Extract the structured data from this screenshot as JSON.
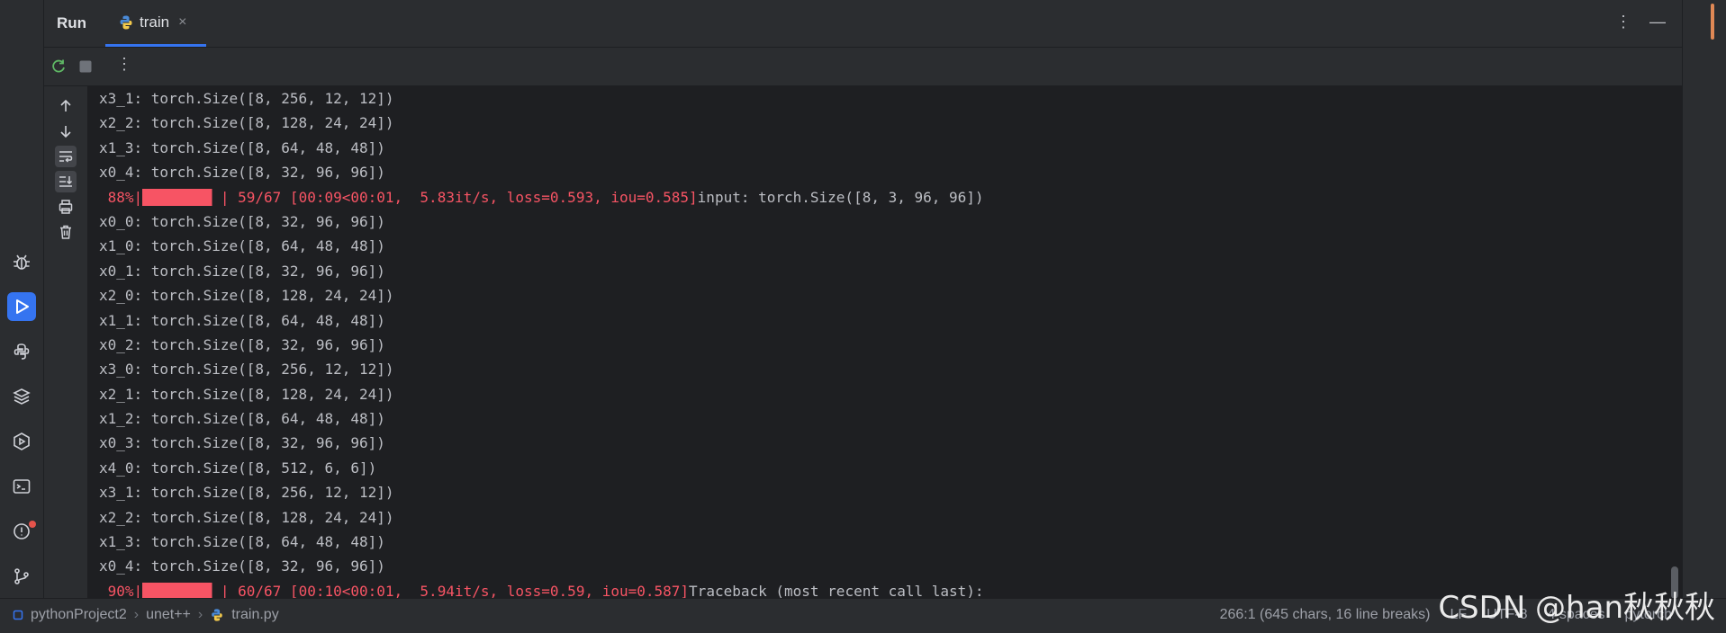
{
  "header": {
    "run_label": "Run",
    "tab_label": "train",
    "tab_close": "×",
    "more_glyph": "⋮",
    "minimize_glyph": "—"
  },
  "toolbar": {
    "more_glyph": "⋮"
  },
  "console": {
    "lines": [
      {
        "text": "x3_1: torch.Size([8, 256, 12, 12])"
      },
      {
        "text": "x2_2: torch.Size([8, 128, 24, 24])"
      },
      {
        "text": "x1_3: torch.Size([8, 64, 48, 48])"
      },
      {
        "text": "x0_4: torch.Size([8, 32, 96, 96])"
      },
      {
        "progress": {
          "pct": " 88%|",
          "bar": "████████",
          "info": " | 59/67 [00:09<00:01,  5.83it/s, loss=0.593, iou=0.585]",
          "tail": "input: torch.Size([8, 3, 96, 96])"
        }
      },
      {
        "text": "x0_0: torch.Size([8, 32, 96, 96])"
      },
      {
        "text": "x1_0: torch.Size([8, 64, 48, 48])"
      },
      {
        "text": "x0_1: torch.Size([8, 32, 96, 96])"
      },
      {
        "text": "x2_0: torch.Size([8, 128, 24, 24])"
      },
      {
        "text": "x1_1: torch.Size([8, 64, 48, 48])"
      },
      {
        "text": "x0_2: torch.Size([8, 32, 96, 96])"
      },
      {
        "text": "x3_0: torch.Size([8, 256, 12, 12])"
      },
      {
        "text": "x2_1: torch.Size([8, 128, 24, 24])"
      },
      {
        "text": "x1_2: torch.Size([8, 64, 48, 48])"
      },
      {
        "text": "x0_3: torch.Size([8, 32, 96, 96])"
      },
      {
        "text": "x4_0: torch.Size([8, 512, 6, 6])"
      },
      {
        "text": "x3_1: torch.Size([8, 256, 12, 12])"
      },
      {
        "text": "x2_2: torch.Size([8, 128, 24, 24])"
      },
      {
        "text": "x1_3: torch.Size([8, 64, 48, 48])"
      },
      {
        "text": "x0_4: torch.Size([8, 32, 96, 96])"
      },
      {
        "progress": {
          "pct": " 90%|",
          "bar": "████████",
          "info": " | 60/67 [00:10<00:01,  5.94it/s, loss=0.59, iou=0.587]",
          "tail": "Traceback (most recent call last):"
        }
      }
    ]
  },
  "statusbar": {
    "project": "pythonProject2",
    "folder": "unet++",
    "file": "train.py",
    "position": "266:1 (645 chars, 16 line breaks)",
    "line_sep": "LF",
    "encoding": "UTF-8",
    "indent": "4 spaces",
    "interpreter": "pytorch"
  },
  "watermark": "CSDN @han秋秋秋",
  "colors": {
    "accent": "#3574f0",
    "progress": "#f75464",
    "background": "#1e1f22",
    "panel": "#2b2d30"
  }
}
